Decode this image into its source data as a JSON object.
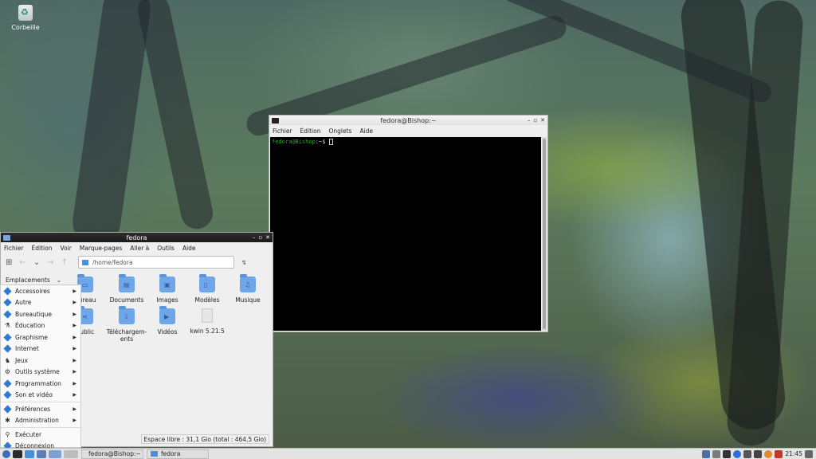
{
  "desktop": {
    "trash_label": "Corbeille"
  },
  "terminal": {
    "title": "fedora@Bishop:~",
    "menu": [
      "Fichier",
      "Édition",
      "Onglets",
      "Aide"
    ],
    "prompt_user": "fedora@Bishop",
    "prompt_rest": ":~$"
  },
  "file_manager": {
    "title": "fedora",
    "menu": [
      "Fichier",
      "Édition",
      "Voir",
      "Marque-pages",
      "Aller à",
      "Outils",
      "Aide"
    ],
    "path": "/home/fedora",
    "sidebar_header": "Emplacements",
    "items": [
      "Bureau",
      "Documents",
      "Images",
      "Modèles",
      "Musique",
      "Public",
      "Téléchargem-ents",
      "Vidéos",
      "kwin 5.21.5"
    ],
    "status": "Espace libre : 31,1 Gio (total : 464,5 Gio)"
  },
  "start_menu": {
    "items": [
      "Accessoires",
      "Autre",
      "Bureautique",
      "Éducation",
      "Graphisme",
      "Internet",
      "Jeux",
      "Outils système",
      "Programmation",
      "Son et vidéo",
      "Préférences",
      "Administration",
      "Exécuter",
      "Déconnexion"
    ]
  },
  "taskbar": {
    "tasks": [
      "fedora@Bishop:~",
      "fedora"
    ],
    "clock": "21:45"
  }
}
